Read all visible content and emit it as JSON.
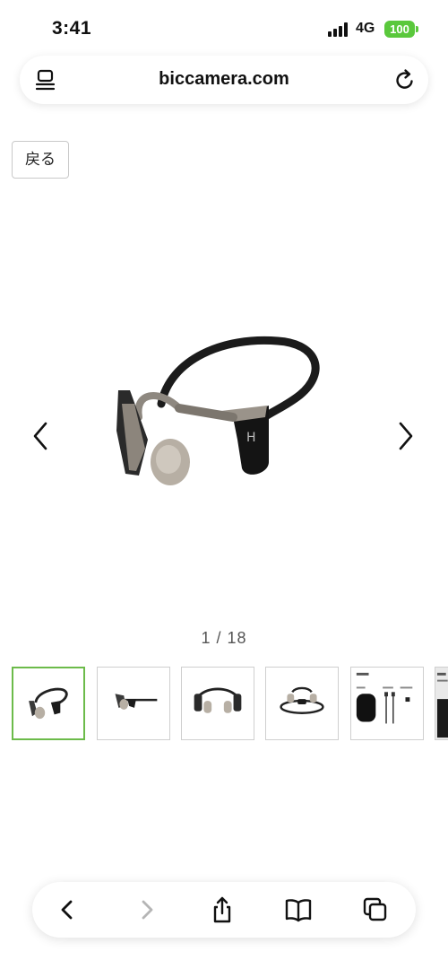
{
  "status": {
    "time": "3:41",
    "network": "4G",
    "battery": "100"
  },
  "browser": {
    "url": "biccamera.com"
  },
  "page": {
    "back_label": "戻る",
    "counter": "1 / 18"
  },
  "thumbnails": [
    {
      "index": 1,
      "selected": true
    },
    {
      "index": 2,
      "selected": false
    },
    {
      "index": 3,
      "selected": false
    },
    {
      "index": 4,
      "selected": false
    },
    {
      "index": 5,
      "selected": false
    },
    {
      "index": 6,
      "selected": false
    }
  ],
  "colors": {
    "selected_border": "#6cbb4a",
    "battery": "#5ac83c"
  }
}
